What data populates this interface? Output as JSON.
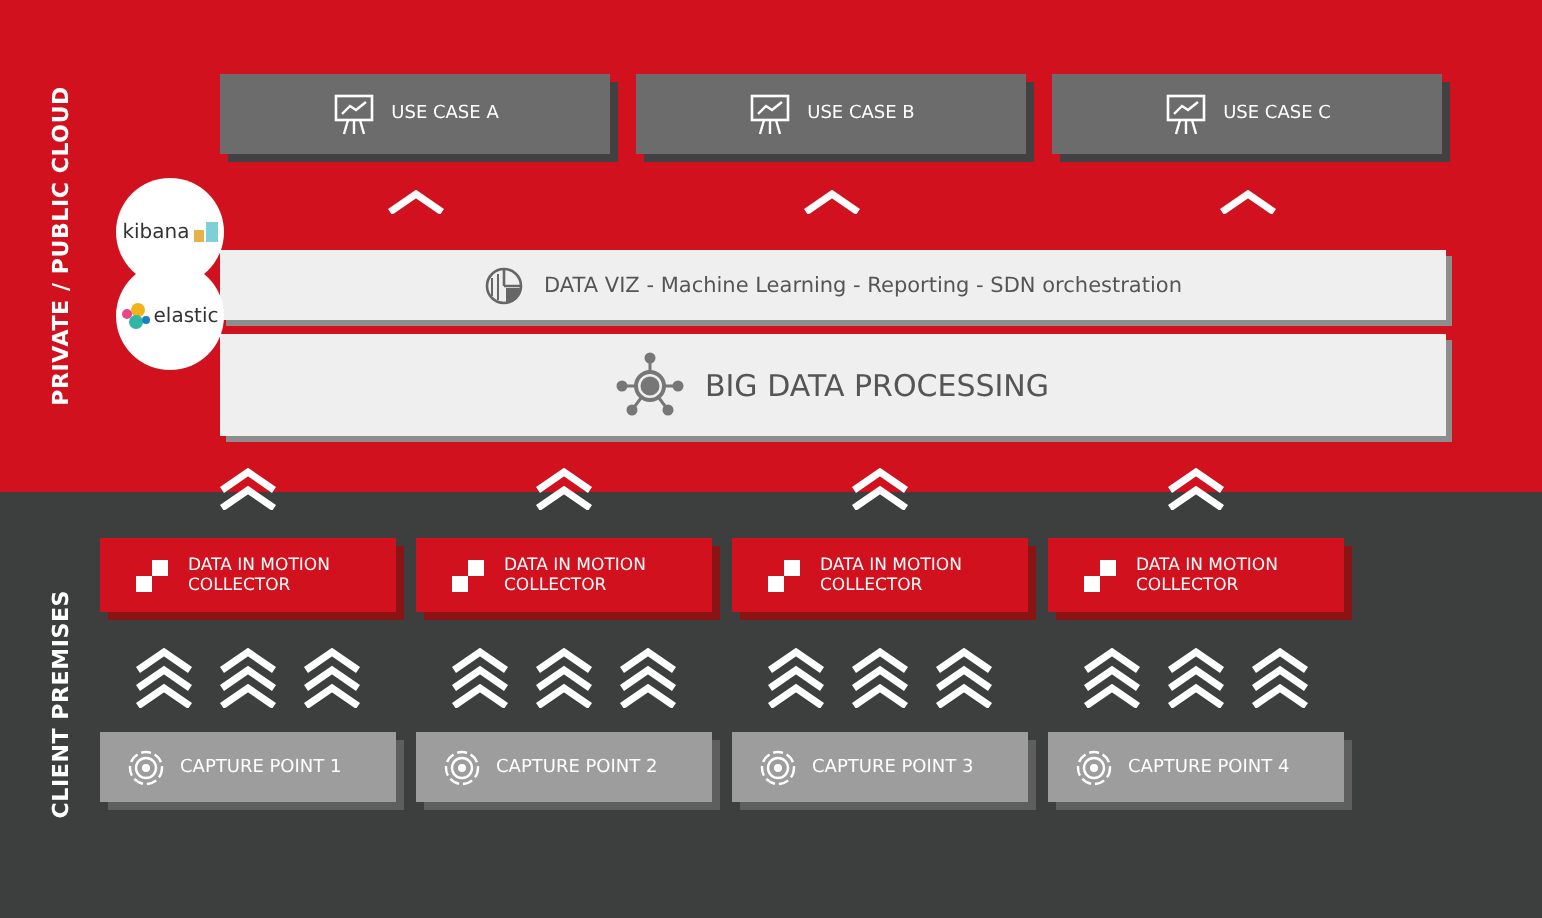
{
  "cloud": {
    "label": "PRIVATE / PUBLIC CLOUD",
    "use_cases": [
      {
        "label": "USE CASE A"
      },
      {
        "label": "USE CASE B"
      },
      {
        "label": "USE CASE C"
      }
    ],
    "layers": [
      {
        "kind": "viz",
        "logo": "kibana",
        "label": "DATA VIZ - Machine Learning - Reporting - SDN orchestration"
      },
      {
        "kind": "processing",
        "logo": "elastic",
        "label": "BIG DATA PROCESSING"
      }
    ]
  },
  "premises": {
    "label": "CLIENT PREMISES",
    "columns": [
      {
        "collector": "DATA IN MOTION COLLECTOR",
        "capture": "CAPTURE POINT 1"
      },
      {
        "collector": "DATA IN MOTION COLLECTOR",
        "capture": "CAPTURE POINT 2"
      },
      {
        "collector": "DATA IN MOTION COLLECTOR",
        "capture": "CAPTURE POINT 3"
      },
      {
        "collector": "DATA IN MOTION COLLECTOR",
        "capture": "CAPTURE POINT 4"
      }
    ]
  }
}
